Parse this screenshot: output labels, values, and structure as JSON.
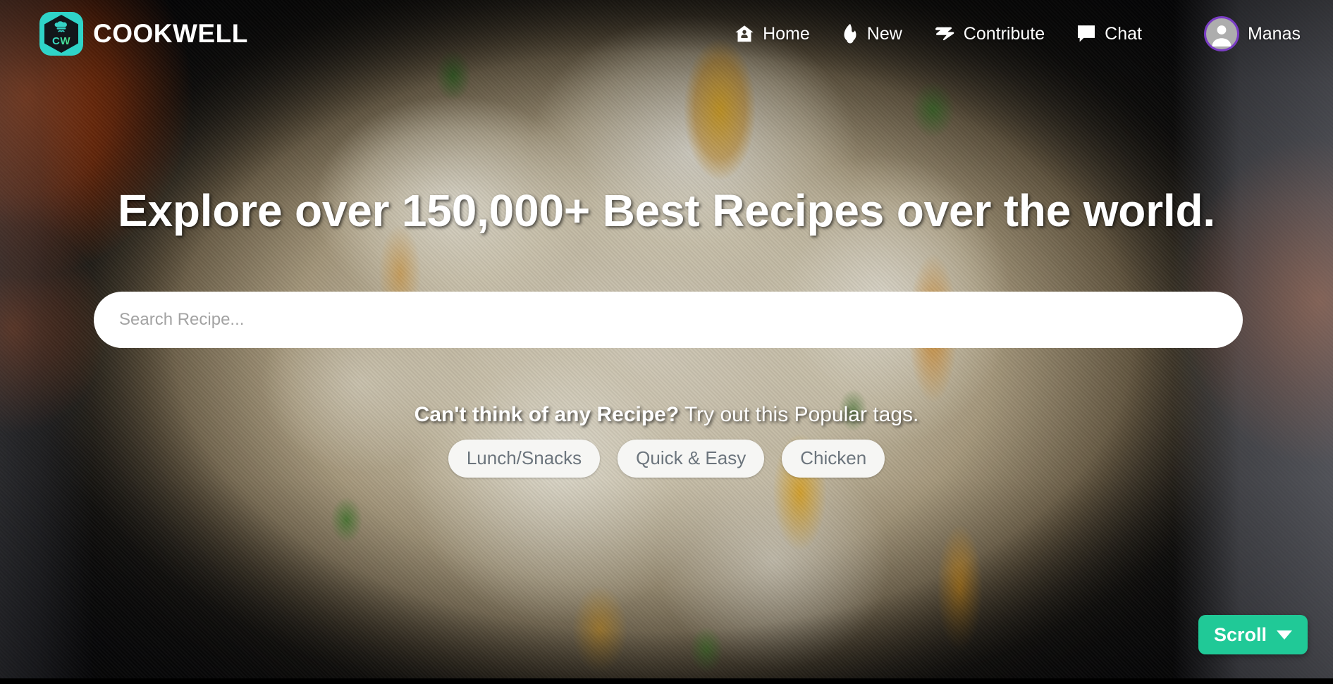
{
  "brand": {
    "name": "COOKWELL",
    "logo_monogram": "CW",
    "logo_bg_color": "#2fd4c8",
    "logo_hex_color": "#12161a"
  },
  "nav": {
    "items": [
      {
        "label": "Home",
        "icon": "home-icon"
      },
      {
        "label": "New",
        "icon": "flame-icon"
      },
      {
        "label": "Contribute",
        "icon": "contribute-icon"
      },
      {
        "label": "Chat",
        "icon": "chat-bubble-icon"
      }
    ]
  },
  "user": {
    "name": "Manas",
    "avatar_icon": "person-icon",
    "avatar_ring_color": "#7a3dc4",
    "avatar_bg_color": "#adadad"
  },
  "hero": {
    "headline": "Explore over 150,000+ Best Recipes over the world."
  },
  "search": {
    "placeholder": "Search Recipe...",
    "value": ""
  },
  "tags": {
    "prompt_strong": "Can't think of any Recipe?",
    "prompt_light": " Try out this Popular tags.",
    "items": [
      {
        "label": "Lunch/Snacks"
      },
      {
        "label": "Quick & Easy"
      },
      {
        "label": "Chicken"
      }
    ],
    "pill_bg_color": "#f6f6f4",
    "pill_text_color": "#6c757d"
  },
  "scroll_button": {
    "label": "Scroll",
    "icon": "caret-down-icon",
    "color": "#20c997"
  }
}
